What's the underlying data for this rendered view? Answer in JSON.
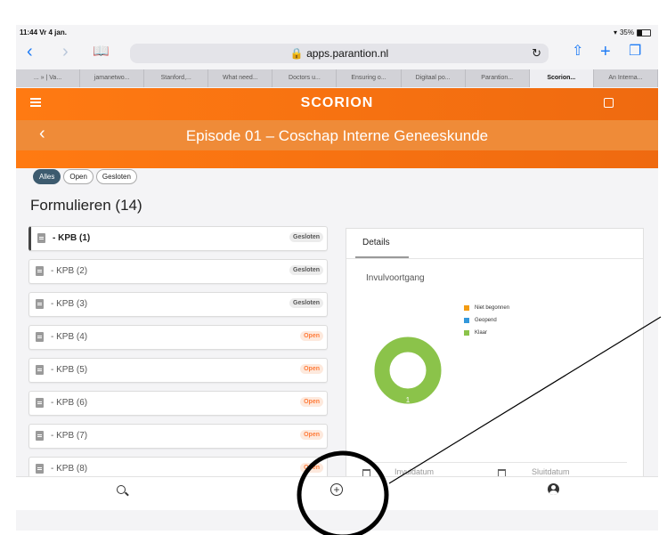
{
  "status": {
    "time": "11:44",
    "date": "Vr 4 jan.",
    "battery": "35%"
  },
  "browser": {
    "url": "apps.parantion.nl",
    "tabs": [
      "... » | Va...",
      "jamanetwo...",
      "Stanford,...",
      "What need...",
      "Doctors u...",
      "Ensuring o...",
      "Digitaal po...",
      "Parantion...",
      "Scorion...",
      "An Interna..."
    ],
    "active_tab": 8
  },
  "app": {
    "logo": "SCORION",
    "episode_title": "Episode 01 – Coschap Interne Geneeskunde"
  },
  "filters": {
    "all": "Alles",
    "open": "Open",
    "closed": "Gesloten"
  },
  "forms_title": "Formulieren (14)",
  "forms": [
    {
      "label": "- KPB (1)",
      "status": "Gesloten",
      "state": "closed"
    },
    {
      "label": "- KPB (2)",
      "status": "Gesloten",
      "state": "closed"
    },
    {
      "label": "- KPB (3)",
      "status": "Gesloten",
      "state": "closed"
    },
    {
      "label": "- KPB (4)",
      "status": "Open",
      "state": "open"
    },
    {
      "label": "- KPB (5)",
      "status": "Open",
      "state": "open"
    },
    {
      "label": "- KPB (6)",
      "status": "Open",
      "state": "open"
    },
    {
      "label": "- KPB (7)",
      "status": "Open",
      "state": "open"
    },
    {
      "label": "- KPB (8)",
      "status": "Open",
      "state": "open"
    }
  ],
  "details": {
    "tab": "Details",
    "progress_title": "Invulvoortgang",
    "legend": [
      {
        "label": "Niet begonnen",
        "color": "#f39c12"
      },
      {
        "label": "Geopend",
        "color": "#3498db"
      },
      {
        "label": "Klaar",
        "color": "#8bc34a"
      }
    ],
    "donut_value": "1",
    "fill_date_label": "Invuldatum",
    "close_date_label": "Sluitdatum"
  },
  "colors": {
    "brand": "#ff7a12",
    "subheader": "#ef8b38",
    "chip_active": "#3d5b6f",
    "done": "#8bc34a"
  },
  "icons": [
    "menu-icon",
    "logout-icon",
    "back-icon",
    "document-icon",
    "calendar-icon",
    "search-icon",
    "add-circle-icon",
    "user-icon"
  ]
}
